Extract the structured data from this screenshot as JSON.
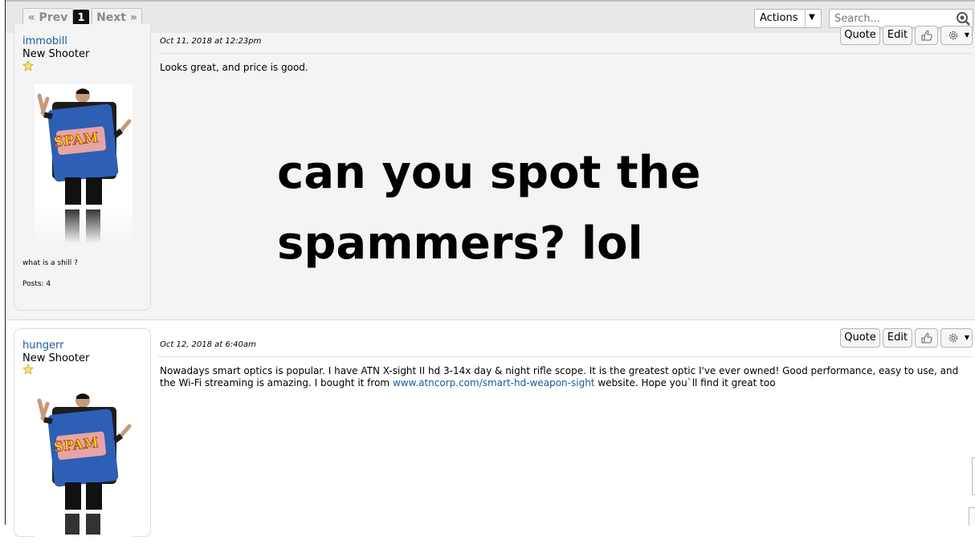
{
  "pagination": {
    "prev_label": "« Prev",
    "current_page": "1",
    "next_label": "Next »"
  },
  "toolbar": {
    "actions_label": "Actions",
    "search_placeholder": "Search..."
  },
  "post_buttons": {
    "quote": "Quote",
    "edit": "Edit"
  },
  "posts": [
    {
      "username": "immobill",
      "rank": "New Shooter",
      "avatar_text": "SPAM",
      "signature": "what is a shill ?",
      "post_count": "Posts: 4",
      "date": "Oct 11, 2018 at 12:23pm",
      "body": "Looks great, and price is good."
    },
    {
      "username": "hungerr",
      "rank": "New Shooter",
      "avatar_text": "SPAM",
      "date": "Oct 12, 2018 at 6:40am",
      "body_before_link": "Nowadays smart optics is popular. I have ATN X-sight II hd 3-14x day & night rifle scope. It is the greatest optic I've ever owned! Good performance, easy to use, and the Wi-Fi streaming is amazing. I bought it from",
      "body_link": "www.atncorp.com/smart-hd-weapon-sight",
      "body_after_link": "website. Hope you`ll find it great too"
    }
  ],
  "overlay_caption": {
    "line1": "can you spot the",
    "line2": "spammers? lol"
  },
  "colors": {
    "link": "#1a5a9a",
    "toolbar_bg": "#e8e8e8",
    "post_bg": "#f4f4f4",
    "spam_blue": "#2d5fb5"
  },
  "icons": [
    "chevron-down-icon",
    "search-icon",
    "thumbs-up-icon",
    "gear-icon",
    "star-icon"
  ]
}
